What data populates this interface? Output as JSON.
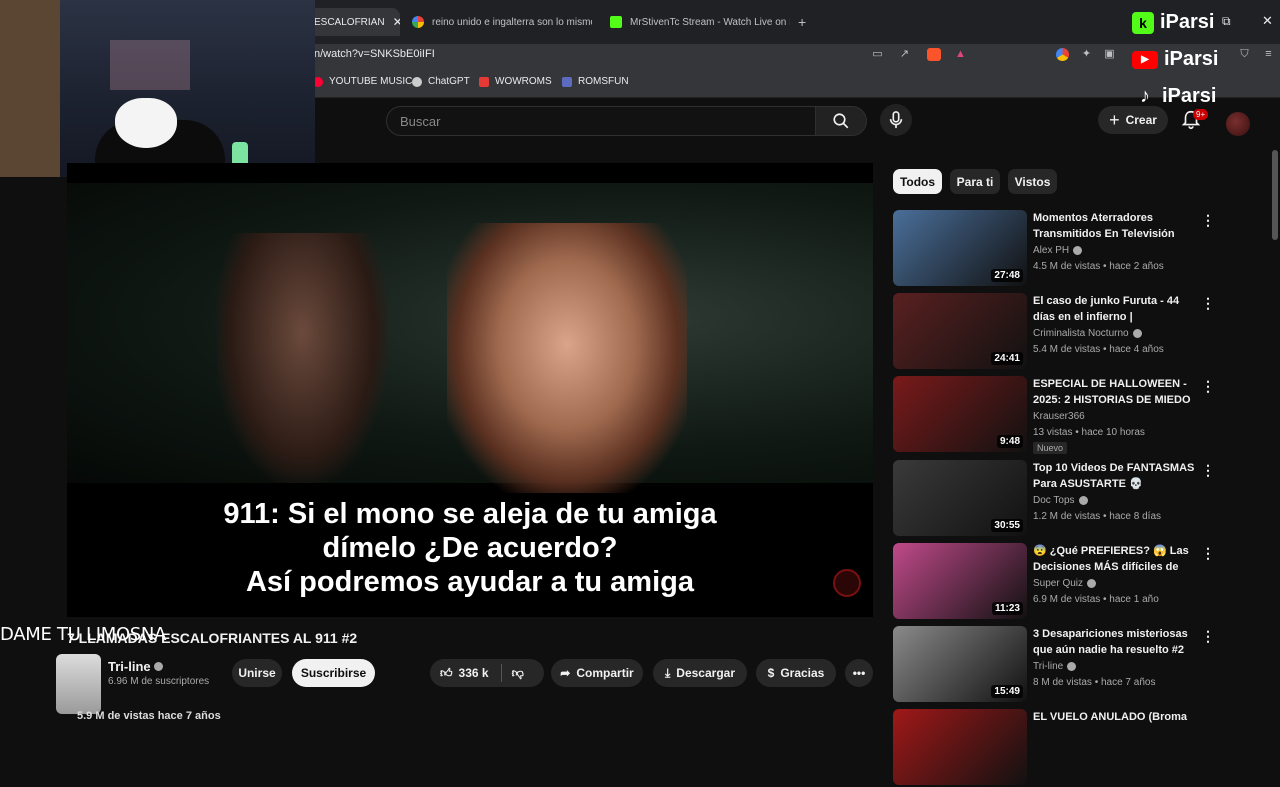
{
  "browser": {
    "tabs": [
      {
        "label": "ESCALOFRIAN",
        "active": true
      },
      {
        "label": "reino unido e ingalterra son lo mismo",
        "active": false
      },
      {
        "label": "MrStivenTc Stream - Watch Live on Ki",
        "active": false
      }
    ],
    "new_tab": "+",
    "url": "n/watch?v=SNKSbE0iIFI",
    "bookmarks": [
      "YOUTUBE MUSIC",
      "ChatGPT",
      "WOWROMS",
      "ROMSFUN"
    ]
  },
  "youtube": {
    "search_placeholder": "Buscar",
    "create_label": "Crear",
    "notif_badge": "9+"
  },
  "overlay": {
    "iparsi_kick": "iParsi",
    "iparsi_youtube": "iParsi",
    "iparsi_tiktok": "iParsi",
    "streamer_text": "DAME TU LIMOSNA"
  },
  "video": {
    "subtitle_lines": [
      "911: Si el mono se aleja de tu amiga",
      "dímelo ¿De acuerdo?",
      "Así podremos ayudar a tu amiga"
    ],
    "title": "7 LLAMADAS ESCALOFRIANTES AL 911 #2",
    "channel": "Tri-line",
    "subscribers": "6.96 M de suscriptores",
    "join_label": "Unirse",
    "subscribe_label": "Suscribirse",
    "likes": "336 k",
    "share_label": "Compartir",
    "download_label": "Descargar",
    "thanks_label": "Gracias",
    "views_line": "5.9 M de vistas  hace 7 años"
  },
  "chips": [
    "Todos",
    "Para ti",
    "Vistos"
  ],
  "recommendations": [
    {
      "title": "Momentos Aterradores Transmitidos En Televisión",
      "channel": "Alex PH",
      "verified": true,
      "meta": "4.5 M de vistas • hace 2 años",
      "duration": "27:48",
      "color": "#4a6f9a"
    },
    {
      "title": "El caso de junko Furuta - 44 días en el infierno | Criminalist...",
      "channel": "Criminalista Nocturno",
      "verified": true,
      "meta": "5.4 M de vistas • hace 4 años",
      "duration": "24:41",
      "color": "#5a2020"
    },
    {
      "title": "ESPECIAL DE HALLOWEEN - 2025: 2 HISTORIAS DE MIEDO",
      "channel": "Krauser366",
      "verified": false,
      "meta": "13 vistas • hace 10 horas",
      "duration": "9:48",
      "color": "#7a1a1a",
      "badge": "Nuevo"
    },
    {
      "title": "Top 10 Videos De FANTASMAS Para ASUSTARTE 💀",
      "channel": "Doc Tops",
      "verified": true,
      "meta": "1.2 M de vistas • hace 8 días",
      "duration": "30:55",
      "color": "#3a3a3a"
    },
    {
      "title": "😨 ¿Qué PREFIERES? 😱 Las Decisiones MÁS difíciles de T...",
      "channel": "Super Quiz",
      "verified": true,
      "meta": "6.9 M de vistas • hace 1 año",
      "duration": "11:23",
      "color": "#c04a8a"
    },
    {
      "title": "3 Desapariciones misteriosas que aún nadie ha resuelto #2",
      "channel": "Tri-line",
      "verified": true,
      "meta": "8 M de vistas • hace 7 años",
      "duration": "15:49",
      "color": "#8a8a8a"
    },
    {
      "title": "EL VUELO ANULADO (Broma",
      "channel": "",
      "verified": false,
      "meta": "",
      "duration": "",
      "color": "#a01818"
    }
  ]
}
